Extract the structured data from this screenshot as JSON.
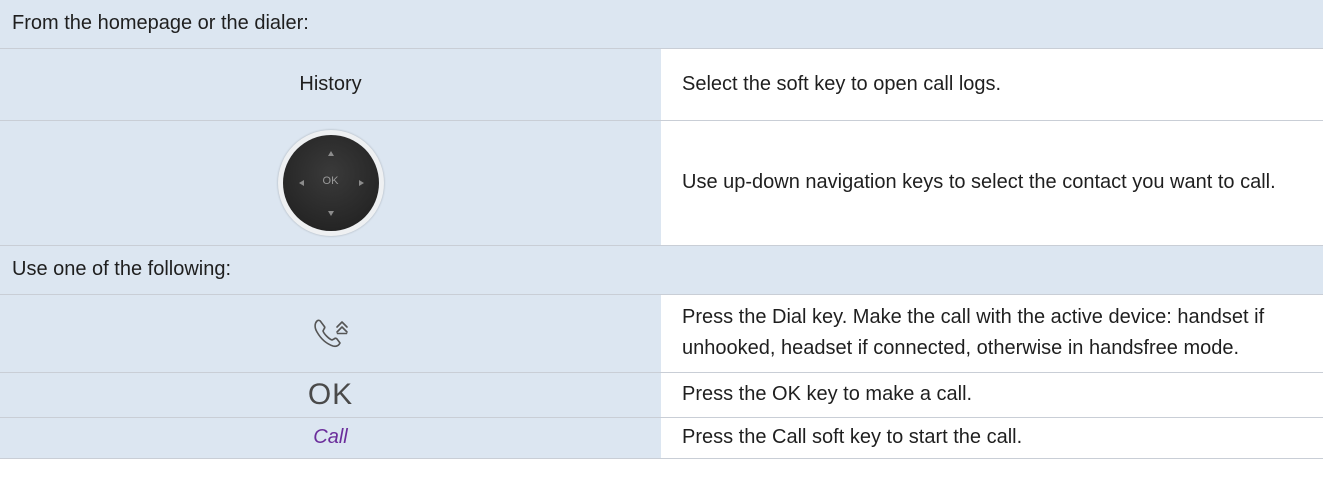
{
  "sections": {
    "intro_header": "From the homepage or the dialer:",
    "options_header": "Use one of the following:"
  },
  "rows": {
    "history": {
      "key_label": "History",
      "description": "Select the soft key to open call logs."
    },
    "navigation": {
      "icon": "navigation-keypad-icon",
      "ok_text": "OK",
      "description": "Use up-down navigation keys to select the contact you want to call."
    },
    "dial": {
      "icon": "dial-key-icon",
      "description": "Press the Dial key. Make the call with the active device: handset if unhooked, headset if connected, otherwise in handsfree mode."
    },
    "ok": {
      "key_label": "OK",
      "description": "Press the OK key to make a call."
    },
    "call": {
      "key_label": "Call",
      "description": "Press the Call soft key to start the call."
    }
  },
  "colors": {
    "header_bg": "#dce6f1",
    "key_cell_bg": "#dce6f1",
    "soft_key_text": "#6b2d9b",
    "divider": "#c9ced6"
  }
}
